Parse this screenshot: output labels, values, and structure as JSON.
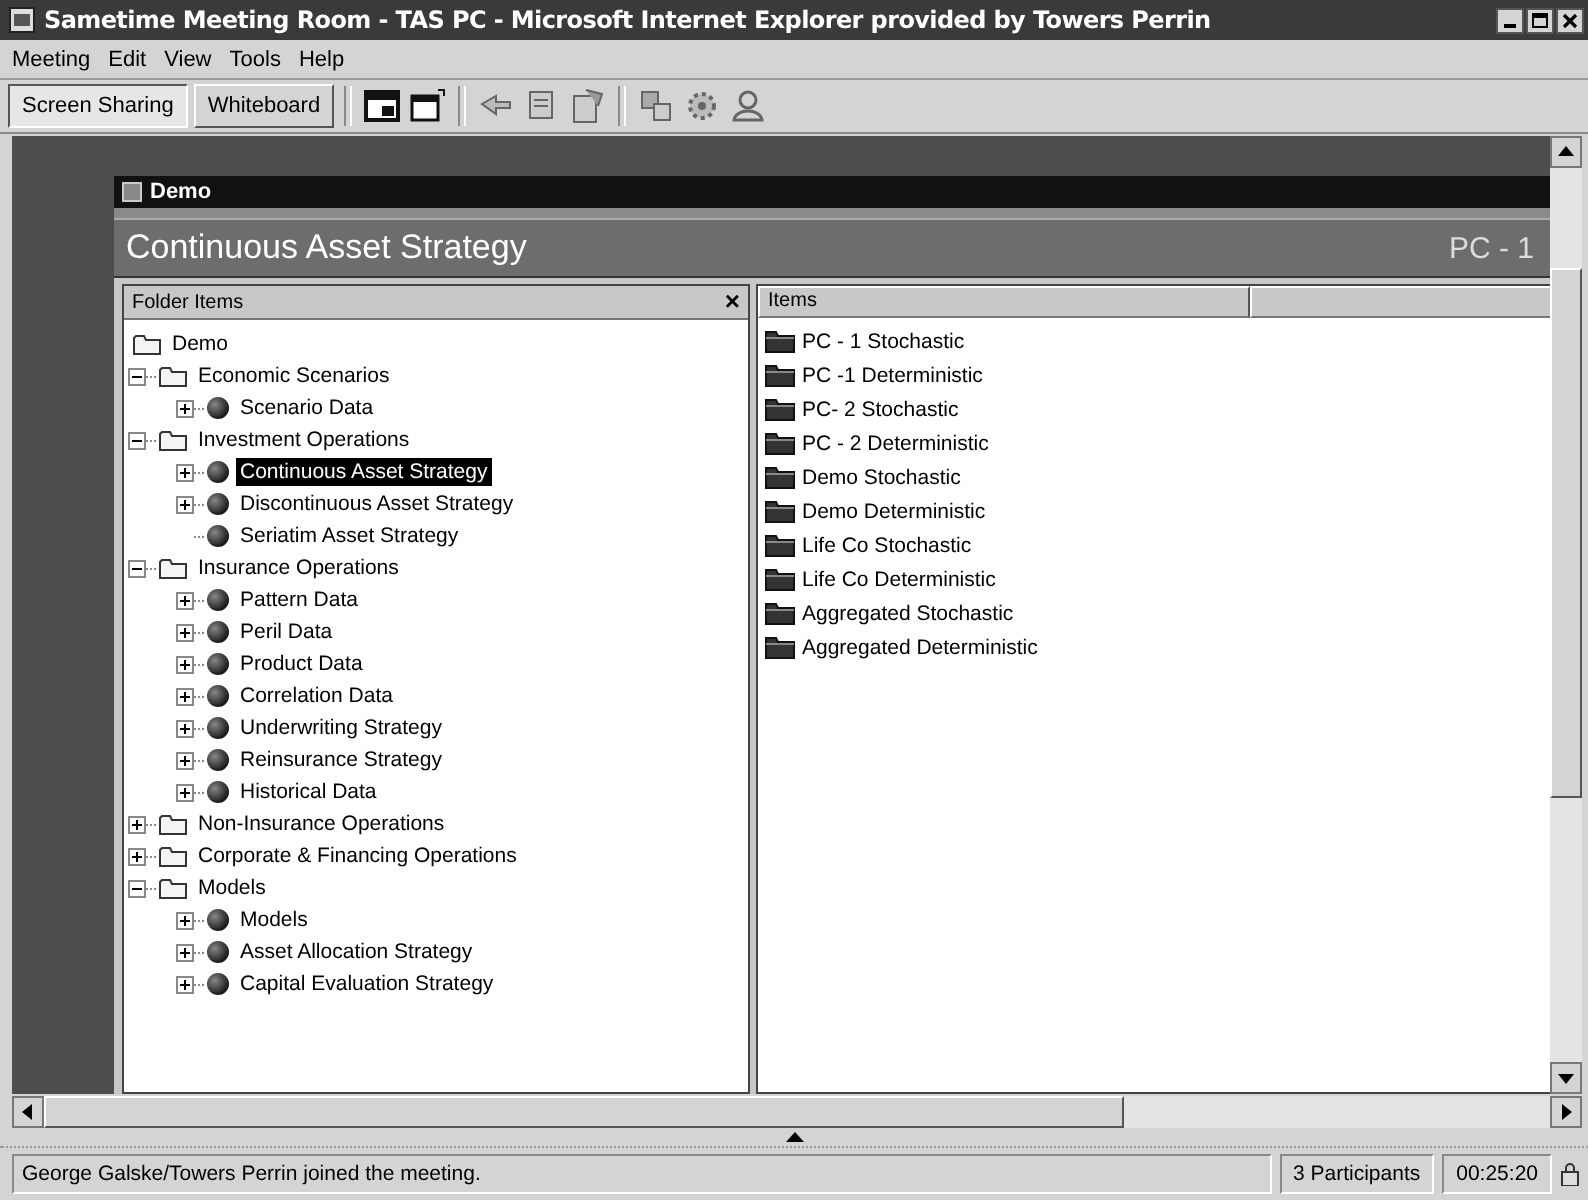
{
  "window": {
    "title": "Sametime Meeting Room - TAS PC - Microsoft Internet Explorer provided by Towers Perrin"
  },
  "menu": [
    "Meeting",
    "Edit",
    "View",
    "Tools",
    "Help"
  ],
  "mode_tabs": [
    {
      "label": "Screen Sharing",
      "selected": true
    },
    {
      "label": "Whiteboard",
      "selected": false
    }
  ],
  "shared_screen": {
    "window_title": "Demo",
    "heading": "Continuous Asset Strategy",
    "heading_right": "PC - 1",
    "folder_pane": {
      "title": "Folder Items",
      "close": "×",
      "tree": [
        {
          "label": "Demo",
          "kind": "folder",
          "selected": false,
          "children": [
            {
              "label": "Economic Scenarios",
              "kind": "folder",
              "expanded": true,
              "selected": false,
              "children": [
                {
                  "label": "Scenario Data",
                  "kind": "model",
                  "expanded": false,
                  "selected": false
                }
              ]
            },
            {
              "label": "Investment Operations",
              "kind": "folder",
              "expanded": true,
              "selected": false,
              "children": [
                {
                  "label": "Continuous Asset Strategy",
                  "kind": "model",
                  "expanded": false,
                  "selected": true
                },
                {
                  "label": "Discontinuous Asset Strategy",
                  "kind": "model",
                  "expanded": false,
                  "selected": false
                },
                {
                  "label": "Seriatim Asset Strategy",
                  "kind": "model",
                  "selected": false
                }
              ]
            },
            {
              "label": "Insurance Operations",
              "kind": "folder",
              "expanded": true,
              "selected": false,
              "children": [
                {
                  "label": "Pattern Data",
                  "kind": "model",
                  "expanded": false,
                  "selected": false
                },
                {
                  "label": "Peril Data",
                  "kind": "model",
                  "expanded": false,
                  "selected": false
                },
                {
                  "label": "Product Data",
                  "kind": "model",
                  "expanded": false,
                  "selected": false
                },
                {
                  "label": "Correlation Data",
                  "kind": "model",
                  "expanded": false,
                  "selected": false
                },
                {
                  "label": "Underwriting Strategy",
                  "kind": "model",
                  "expanded": false,
                  "selected": false
                },
                {
                  "label": "Reinsurance Strategy",
                  "kind": "model",
                  "expanded": false,
                  "selected": false
                },
                {
                  "label": "Historical Data",
                  "kind": "model",
                  "expanded": false,
                  "selected": false
                }
              ]
            },
            {
              "label": "Non-Insurance Operations",
              "kind": "folder",
              "expanded": false,
              "selected": false
            },
            {
              "label": "Corporate & Financing Operations",
              "kind": "folder",
              "expanded": false,
              "selected": false
            },
            {
              "label": "Models",
              "kind": "folder",
              "expanded": true,
              "selected": false,
              "children": [
                {
                  "label": "Models",
                  "kind": "model",
                  "expanded": false,
                  "selected": false
                },
                {
                  "label": "Asset Allocation Strategy",
                  "kind": "model",
                  "expanded": false,
                  "selected": false
                },
                {
                  "label": "Capital Evaluation Strategy",
                  "kind": "model",
                  "expanded": false,
                  "selected": false
                }
              ]
            }
          ]
        }
      ]
    },
    "items_pane": {
      "columns": [
        "Items"
      ],
      "items": [
        "PC - 1 Stochastic",
        "PC -1 Deterministic",
        "PC- 2 Stochastic",
        "PC - 2 Deterministic",
        "Demo Stochastic",
        "Demo Deterministic",
        "Life Co Stochastic",
        "Life Co Deterministic",
        "Aggregated Stochastic",
        "Aggregated Deterministic"
      ]
    }
  },
  "status_bar": {
    "message": "George Galske/Towers Perrin joined the meeting.",
    "participants": "3 Participants",
    "time": "00:25:20"
  }
}
